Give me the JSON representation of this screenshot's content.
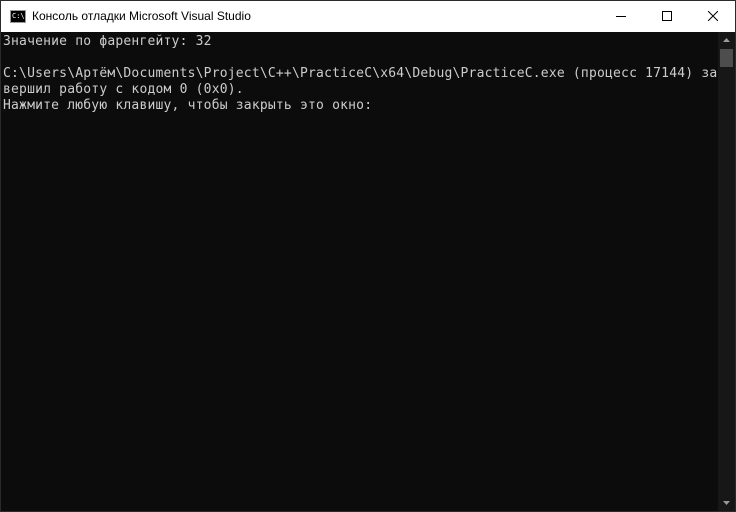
{
  "window": {
    "title": "Консоль отладки Microsoft Visual Studio",
    "icon": "console-app-icon",
    "icon_glyph": "C:\\"
  },
  "controls": {
    "minimize": "minimize-icon",
    "maximize": "maximize-icon",
    "close": "close-icon"
  },
  "console": {
    "lines": [
      "Значение по фаренгейту: 32",
      "C:\\Users\\Артём\\Documents\\Project\\C++\\PracticeC\\x64\\Debug\\PracticeC.exe (процесс 17144) за",
      "вершил работу с кодом 0 (0x0).",
      "Нажмите любую клавишу, чтобы закрыть это окно:"
    ],
    "background": "#0c0c0c",
    "foreground": "#cccccc"
  },
  "scrollbar": {
    "track_color": "#171717",
    "thumb_color": "#4d4d4d"
  }
}
